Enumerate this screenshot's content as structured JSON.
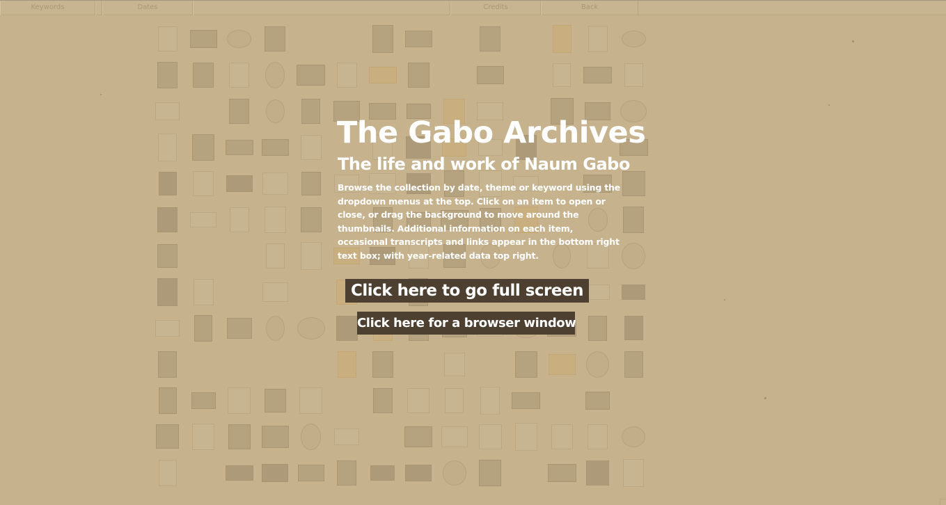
{
  "nav": {
    "keywords": "Keywords",
    "dates": "Dates",
    "credits": "Credits",
    "back": "Back"
  },
  "intro": {
    "title": "The Gabo Archives",
    "subtitle": "The life and work of Naum Gabo",
    "description": "Browse the collection by date, theme or keyword using the dropdown menus at the top. Click on an item to open or close, or drag the background to move around the thumbnails. Additional information on each item, occasional transcripts and links appear in the bottom right text box; with year-related data top right."
  },
  "buttons": {
    "full_screen": "Click here to go full screen",
    "browser_window": "Click here for a browser window"
  },
  "colors": {
    "background": "#c6b28d",
    "button": "#4d4030",
    "text": "#ffffff"
  }
}
